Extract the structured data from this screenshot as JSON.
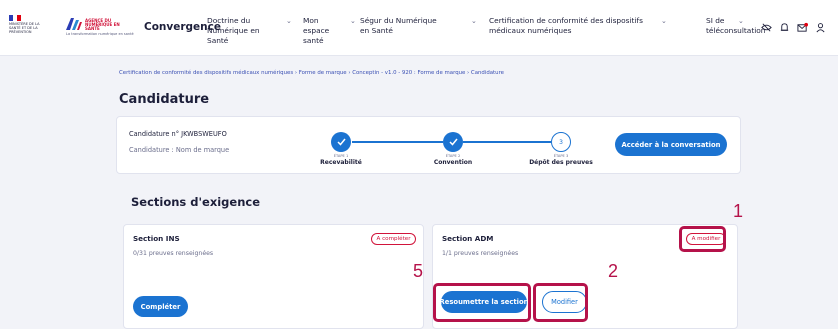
{
  "header": {
    "logo1_text": "MINISTÈRE DE LA SANTÉ ET DE LA PRÉVENTION",
    "logo2_title": "AGENCE DU NUMÉRIQUE EN SANTÉ",
    "logo2_sub": "La transformation numérique en santé",
    "brand": "Convergence",
    "nav": [
      {
        "label": "Doctrine du Numérique en Santé"
      },
      {
        "label": "Mon espace santé"
      },
      {
        "label": "Ségur du Numérique en Santé"
      },
      {
        "label": "Certification de conformité des dispositifs médicaux numériques"
      },
      {
        "label": "SI de téléconsultation"
      }
    ],
    "icons": [
      "eye-off-icon",
      "bell-icon",
      "mail-icon",
      "user-icon"
    ]
  },
  "breadcrumb": "Certification de conformité des dispositifs médicaux numériques  ›  Forme de marque  ›  Conceptin - v1.0 - 920 : Forme de marque  ›  Candidature",
  "page_title": "Candidature",
  "candidature": {
    "number_label": "Candidature n° JKWBSWEUFO",
    "name_label": "Candidature : Nom de marque",
    "steps": [
      {
        "num": "ÉTAPE 1",
        "label": "Recevabilité",
        "status": "done"
      },
      {
        "num": "ÉTAPE 2",
        "label": "Convention",
        "status": "done"
      },
      {
        "num": "ÉTAPE 3",
        "label": "Dépôt des preuves",
        "status": "current",
        "index": "3"
      }
    ],
    "conversation_button": "Accéder à la conversation"
  },
  "sections": {
    "title": "Sections d'exigence",
    "items": [
      {
        "name": "Section INS",
        "count": "0/31 preuves renseignées",
        "badge": "A compléter",
        "button": "Compléter"
      },
      {
        "name": "Section ADM",
        "count": "1/1 preuves renseignées",
        "badge": "A modifier",
        "resubmit_button": "Resoumettre la section",
        "edit_button": "Modifier"
      }
    ]
  },
  "annotations": {
    "a1": "1",
    "a2": "2",
    "a5": "5"
  },
  "colors": {
    "primary": "#1b73d1",
    "highlight": "#b5124a",
    "badge": "#d1143b"
  }
}
